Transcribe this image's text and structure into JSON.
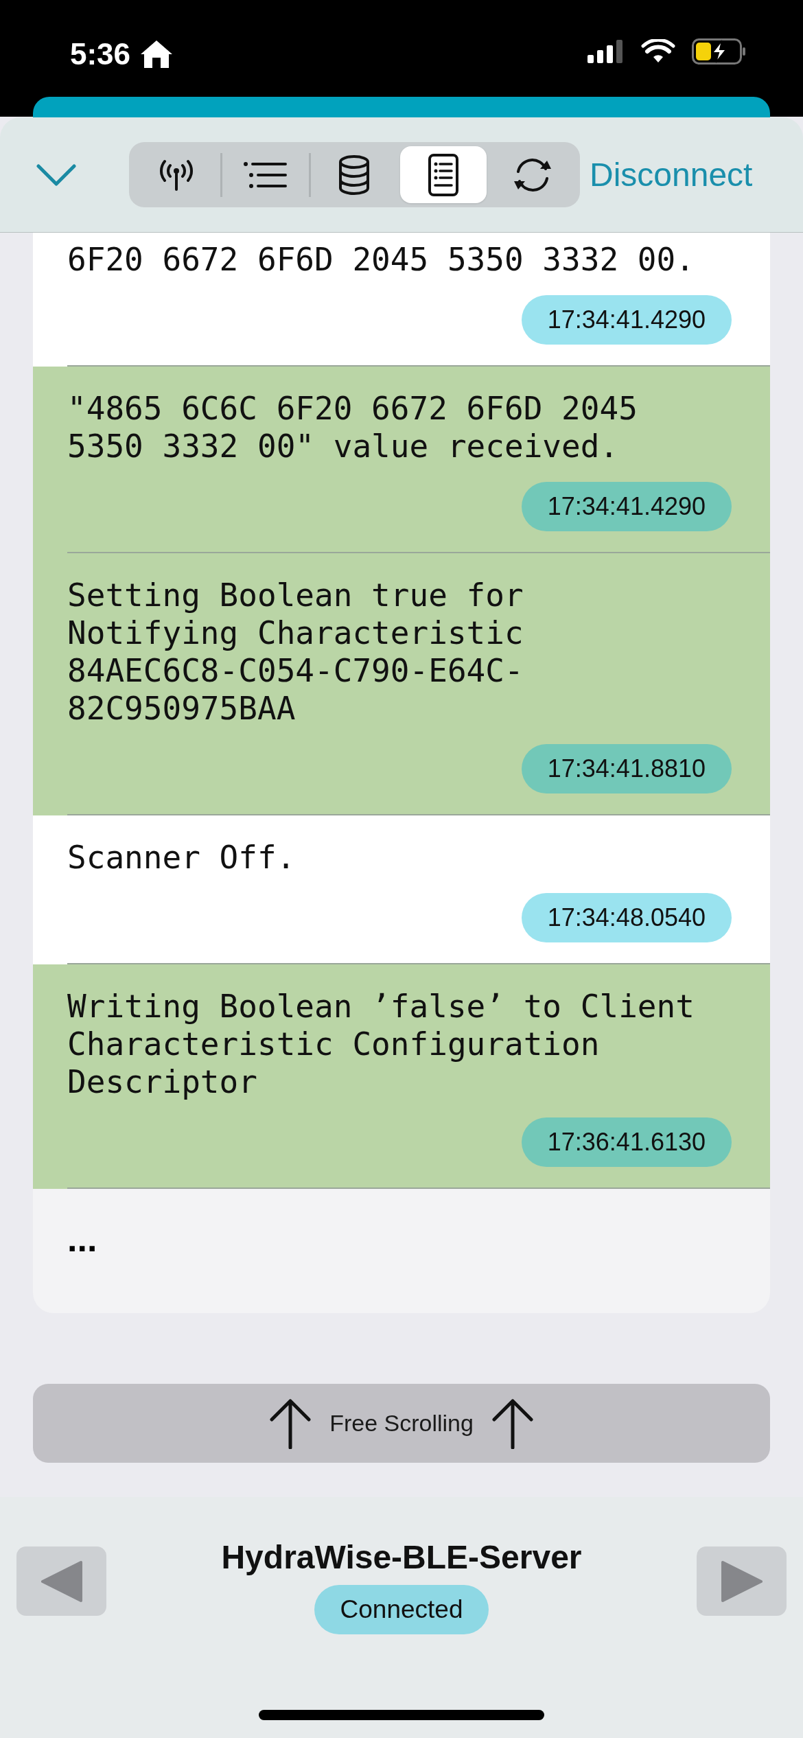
{
  "status_bar": {
    "time": "5:36"
  },
  "toolbar": {
    "segments": [
      {
        "selected": false
      },
      {
        "selected": false
      },
      {
        "selected": false
      },
      {
        "selected": true
      },
      {
        "selected": false
      }
    ],
    "action": "Disconnect"
  },
  "log": {
    "entries": [
      {
        "text": "6F20 6672 6F6D 2045 5350 3332 00.",
        "time": "17:34:41.4290",
        "highlighted": false
      },
      {
        "text": "\"4865 6C6C 6F20 6672 6F6D 2045 5350 3332 00\" value received.",
        "time": "17:34:41.4290",
        "highlighted": true
      },
      {
        "text": "Setting Boolean true for Notifying Characteristic 84AEC6C8-C054-C790-E64C-82C950975BAA",
        "time": "17:34:41.8810",
        "highlighted": true
      },
      {
        "text": "Scanner Off.",
        "time": "17:34:48.0540",
        "highlighted": false
      },
      {
        "text": "Writing Boolean ʼfalseʼ to Client Characteristic Configuration Descriptor",
        "time": "17:36:41.6130",
        "highlighted": true
      }
    ],
    "more": "..."
  },
  "scroll_button": "Free Scrolling",
  "device": {
    "name": "HydraWise-BLE-Server",
    "status": "Connected"
  }
}
